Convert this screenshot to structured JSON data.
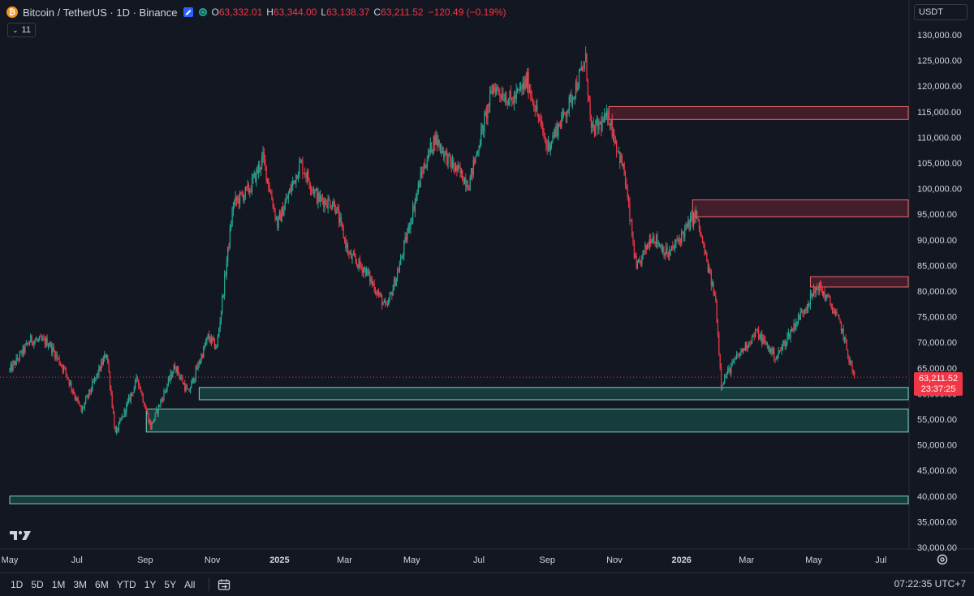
{
  "legend": {
    "symbol_title": "Bitcoin / TetherUS · 1D · Binance",
    "coin_glyph": "₿",
    "open_label": "O",
    "open": "63,332.01",
    "high_label": "H",
    "high": "63,344.00",
    "low_label": "L",
    "low": "63,138.37",
    "close_label": "C",
    "close": "63,211.52",
    "change": "−120.49 (−0.19%)"
  },
  "indicators": {
    "count": "11"
  },
  "currency": "USDT",
  "price_tag": {
    "price": "63,211.52",
    "countdown": "23:37:25"
  },
  "bottom_bar": {
    "ranges": [
      "1D",
      "5D",
      "1M",
      "3M",
      "6M",
      "YTD",
      "1Y",
      "5Y",
      "All"
    ],
    "clock": "07:22:35 UTC+7"
  },
  "colors": {
    "background": "#131722",
    "up": "#22ab94",
    "down": "#f23645",
    "supply_zone": "#f23645",
    "demand_zone": "#22ab94"
  },
  "chart_data": {
    "type": "candlestick",
    "y_axis_labels": [
      "130,000.00",
      "125,000.00",
      "120,000.00",
      "115,000.00",
      "110,000.00",
      "105,000.00",
      "100,000.00",
      "95,000.00",
      "90,000.00",
      "85,000.00",
      "80,000.00",
      "75,000.00",
      "70,000.00",
      "65,000.00",
      "60,000.00",
      "55,000.00",
      "50,000.00",
      "45,000.00",
      "40,000.00",
      "35,000.00",
      "30,000.00"
    ],
    "y_range": [
      30000,
      130000
    ],
    "x_range": [
      "2024-05-01",
      "2026-07-31"
    ],
    "x_axis_labels": [
      {
        "label": "May",
        "date": "2024-05-01",
        "bold": false
      },
      {
        "label": "Jul",
        "date": "2024-07-01",
        "bold": false
      },
      {
        "label": "Sep",
        "date": "2024-09-01",
        "bold": false
      },
      {
        "label": "Nov",
        "date": "2024-11-01",
        "bold": false
      },
      {
        "label": "2025",
        "date": "2025-01-01",
        "bold": true
      },
      {
        "label": "Mar",
        "date": "2025-03-01",
        "bold": false
      },
      {
        "label": "May",
        "date": "2025-05-01",
        "bold": false
      },
      {
        "label": "Jul",
        "date": "2025-07-01",
        "bold": false
      },
      {
        "label": "Sep",
        "date": "2025-09-01",
        "bold": false
      },
      {
        "label": "Nov",
        "date": "2025-11-01",
        "bold": false
      },
      {
        "label": "2026",
        "date": "2026-01-01",
        "bold": true
      },
      {
        "label": "Mar",
        "date": "2026-03-01",
        "bold": false
      },
      {
        "label": "May",
        "date": "2026-05-01",
        "bold": false
      },
      {
        "label": "Jul",
        "date": "2026-07-01",
        "bold": false
      }
    ],
    "last_price": 63211.52,
    "price_path": [
      [
        "2024-05-01",
        64500
      ],
      [
        "2024-05-20",
        70500
      ],
      [
        "2024-06-05",
        70000
      ],
      [
        "2024-06-20",
        64500
      ],
      [
        "2024-07-05",
        56500
      ],
      [
        "2024-07-28",
        68000
      ],
      [
        "2024-08-05",
        52000
      ],
      [
        "2024-08-25",
        63000
      ],
      [
        "2024-09-06",
        53500
      ],
      [
        "2024-09-28",
        65500
      ],
      [
        "2024-10-10",
        60000
      ],
      [
        "2024-10-28",
        71000
      ],
      [
        "2024-11-05",
        69000
      ],
      [
        "2024-11-20",
        97000
      ],
      [
        "2024-12-05",
        100000
      ],
      [
        "2024-12-17",
        106000
      ],
      [
        "2024-12-30",
        93000
      ],
      [
        "2025-01-20",
        105000
      ],
      [
        "2025-02-05",
        98000
      ],
      [
        "2025-02-20",
        97000
      ],
      [
        "2025-03-05",
        87000
      ],
      [
        "2025-03-20",
        84000
      ],
      [
        "2025-04-08",
        76500
      ],
      [
        "2025-04-20",
        85000
      ],
      [
        "2025-05-10",
        103000
      ],
      [
        "2025-05-22",
        110000
      ],
      [
        "2025-06-05",
        105000
      ],
      [
        "2025-06-22",
        101000
      ],
      [
        "2025-07-14",
        120000
      ],
      [
        "2025-07-31",
        117000
      ],
      [
        "2025-08-14",
        121000
      ],
      [
        "2025-09-01",
        108000
      ],
      [
        "2025-09-20",
        116000
      ],
      [
        "2025-10-06",
        125000
      ],
      [
        "2025-10-11",
        111000
      ],
      [
        "2025-10-27",
        114000
      ],
      [
        "2025-11-10",
        103000
      ],
      [
        "2025-11-21",
        84000
      ],
      [
        "2025-12-05",
        91000
      ],
      [
        "2025-12-20",
        87000
      ],
      [
        "2026-01-14",
        95000
      ],
      [
        "2026-02-01",
        78000
      ],
      [
        "2026-02-06",
        62000
      ],
      [
        "2026-02-20",
        67000
      ],
      [
        "2026-03-10",
        72000
      ],
      [
        "2026-03-28",
        67000
      ],
      [
        "2026-04-15",
        74000
      ],
      [
        "2026-05-05",
        81000
      ],
      [
        "2026-05-15",
        78000
      ],
      [
        "2026-05-26",
        73000
      ],
      [
        "2026-06-03",
        66000
      ],
      [
        "2026-06-07",
        63211.52
      ]
    ],
    "zones": [
      {
        "kind": "supply",
        "from": "2025-10-27",
        "to": "2026-07-31",
        "low": 113500,
        "high": 116000
      },
      {
        "kind": "supply",
        "from": "2026-01-11",
        "to": "2026-07-31",
        "low": 94500,
        "high": 97800
      },
      {
        "kind": "supply",
        "from": "2026-04-28",
        "to": "2026-07-31",
        "low": 80800,
        "high": 82800
      },
      {
        "kind": "demand",
        "from": "2024-10-20",
        "to": "2026-07-31",
        "low": 58800,
        "high": 61200
      },
      {
        "kind": "demand",
        "from": "2024-09-02",
        "to": "2026-07-31",
        "low": 52500,
        "high": 57000
      },
      {
        "kind": "demand",
        "from": "2024-05-01",
        "to": "2026-07-31",
        "low": 38500,
        "high": 40000
      }
    ]
  }
}
